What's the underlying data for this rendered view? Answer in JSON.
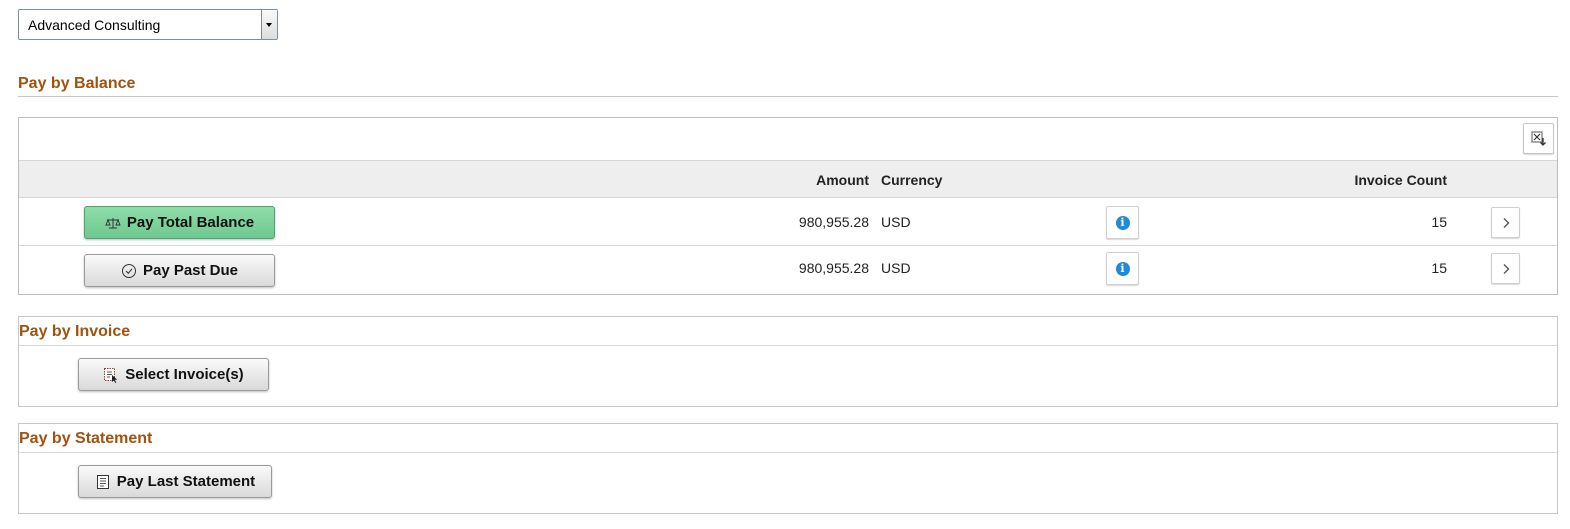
{
  "selector": {
    "value": "Advanced Consulting"
  },
  "pay_by_balance": {
    "title": "Pay by Balance",
    "columns": {
      "amount": "Amount",
      "currency": "Currency",
      "invoice_count": "Invoice Count"
    },
    "rows": [
      {
        "action": "Pay Total Balance",
        "amount": "980,955.28",
        "currency": "USD",
        "invoice_count": "15"
      },
      {
        "action": "Pay Past Due",
        "amount": "980,955.28",
        "currency": "USD",
        "invoice_count": "15"
      }
    ]
  },
  "pay_by_invoice": {
    "title": "Pay by Invoice",
    "button": "Select Invoice(s)"
  },
  "pay_by_statement": {
    "title": "Pay by Statement",
    "button": "Pay Last Statement"
  },
  "icons": {
    "export": "export-excel-icon",
    "balance": "scale-icon",
    "past_due": "clock-check-icon",
    "info": "info-icon",
    "chevron": "chevron-right-icon",
    "invoice": "select-invoice-icon",
    "statement": "statement-icon"
  },
  "colors": {
    "accent": "#a0520f",
    "green_button": "#7dd39c",
    "info": "#1f8ad6"
  }
}
